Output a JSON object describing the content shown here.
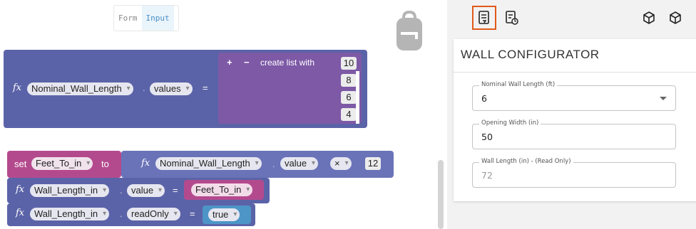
{
  "mode_toggle": {
    "form_label": "Form",
    "input_label": "Input",
    "active": "Input"
  },
  "block1": {
    "fx": "fx",
    "variable": "Nominal_Wall_Length",
    "dot": ".",
    "property": "values",
    "equals": "=",
    "list_label": "create list with",
    "plus": "+",
    "minus": "−",
    "items": [
      "10",
      "8",
      "6",
      "4"
    ]
  },
  "block2": {
    "set_label": "set",
    "variable": "Feet_To_in",
    "to_label": "to",
    "fx": "fx",
    "source_variable": "Nominal_Wall_Length",
    "dot": ".",
    "source_property": "value",
    "operator": "×",
    "operand": "12"
  },
  "block3": {
    "fx": "fx",
    "variable": "Wall_Length_in",
    "dot": ".",
    "property": "value",
    "equals": "=",
    "value_variable": "Feet_To_in"
  },
  "block4": {
    "fx": "fx",
    "variable": "Wall_Length_in",
    "dot": ".",
    "property": "readOnly",
    "equals": "=",
    "value": "true"
  },
  "panel": {
    "title": "WALL CONFIGURATOR",
    "fields": [
      {
        "label": "Nominal Wall Length (ft)",
        "value": "6",
        "type": "select"
      },
      {
        "label": "Opening Width (in)",
        "value": "50",
        "type": "input"
      },
      {
        "label": "Wall Length (in) - (Read Only)",
        "value": "72",
        "type": "readonly"
      }
    ]
  },
  "colors": {
    "accent": "#e05a1a",
    "block_dark": "#5b63a8",
    "block_purple": "#7d59a6",
    "block_magenta": "#b44a8e"
  }
}
